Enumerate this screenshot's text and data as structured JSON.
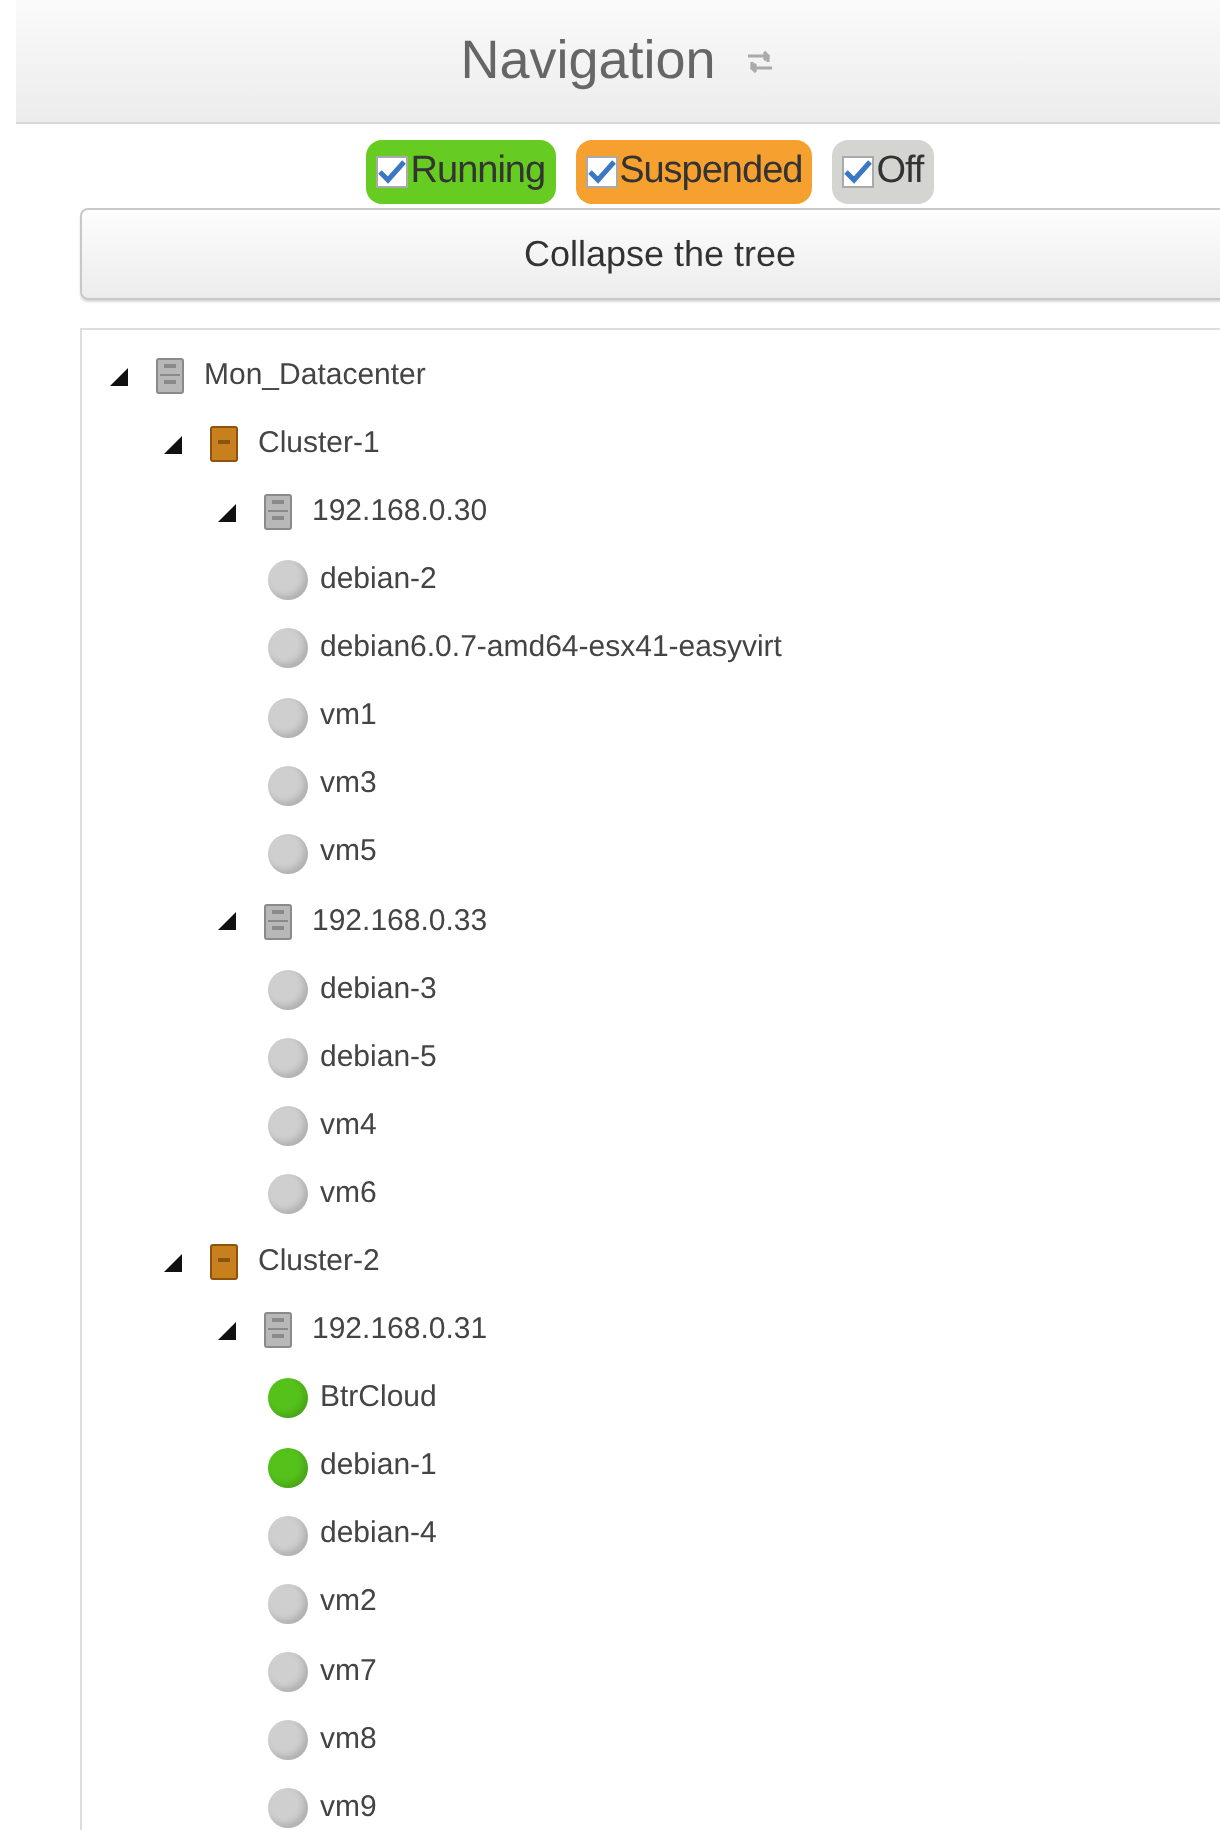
{
  "header": {
    "title": "Navigation"
  },
  "filters": [
    {
      "label": "Running",
      "kind": "running",
      "checked": true
    },
    {
      "label": "Suspended",
      "kind": "suspended",
      "checked": true
    },
    {
      "label": "Off",
      "kind": "off",
      "checked": true
    }
  ],
  "collapse_button": {
    "label": "Collapse the tree"
  },
  "tree": [
    {
      "label": "Mon_Datacenter",
      "kind": "server",
      "expanded": true,
      "children": [
        {
          "label": "Cluster-1",
          "kind": "cluster",
          "expanded": true,
          "children": [
            {
              "label": "192.168.0.30",
              "kind": "server",
              "expanded": true,
              "children": [
                {
                  "label": "debian-2",
                  "kind": "vm",
                  "color": "#cfcfcf"
                },
                {
                  "label": "debian6.0.7-amd64-esx41-easyvirt",
                  "kind": "vm",
                  "color": "#cfcfcf"
                },
                {
                  "label": "vm1",
                  "kind": "vm",
                  "color": "#cfcfcf"
                },
                {
                  "label": "vm3",
                  "kind": "vm",
                  "color": "#cfcfcf"
                },
                {
                  "label": "vm5",
                  "kind": "vm",
                  "color": "#cfcfcf"
                }
              ]
            },
            {
              "label": "192.168.0.33",
              "kind": "server",
              "expanded": true,
              "children": [
                {
                  "label": "debian-3",
                  "kind": "vm",
                  "color": "#cfcfcf"
                },
                {
                  "label": "debian-5",
                  "kind": "vm",
                  "color": "#cfcfcf"
                },
                {
                  "label": "vm4",
                  "kind": "vm",
                  "color": "#cfcfcf"
                },
                {
                  "label": "vm6",
                  "kind": "vm",
                  "color": "#cfcfcf"
                }
              ]
            }
          ]
        },
        {
          "label": "Cluster-2",
          "kind": "cluster",
          "expanded": true,
          "children": [
            {
              "label": "192.168.0.31",
              "kind": "server",
              "expanded": true,
              "children": [
                {
                  "label": "BtrCloud",
                  "kind": "vm",
                  "color": "#55c21b"
                },
                {
                  "label": "debian-1",
                  "kind": "vm",
                  "color": "#55c21b"
                },
                {
                  "label": "debian-4",
                  "kind": "vm",
                  "color": "#cfcfcf"
                },
                {
                  "label": "vm2",
                  "kind": "vm",
                  "color": "#cfcfcf"
                },
                {
                  "label": "vm7",
                  "kind": "vm",
                  "color": "#cfcfcf"
                },
                {
                  "label": "vm8",
                  "kind": "vm",
                  "color": "#cfcfcf"
                },
                {
                  "label": "vm9",
                  "kind": "vm",
                  "color": "#cfcfcf"
                }
              ]
            }
          ]
        }
      ]
    }
  ]
}
